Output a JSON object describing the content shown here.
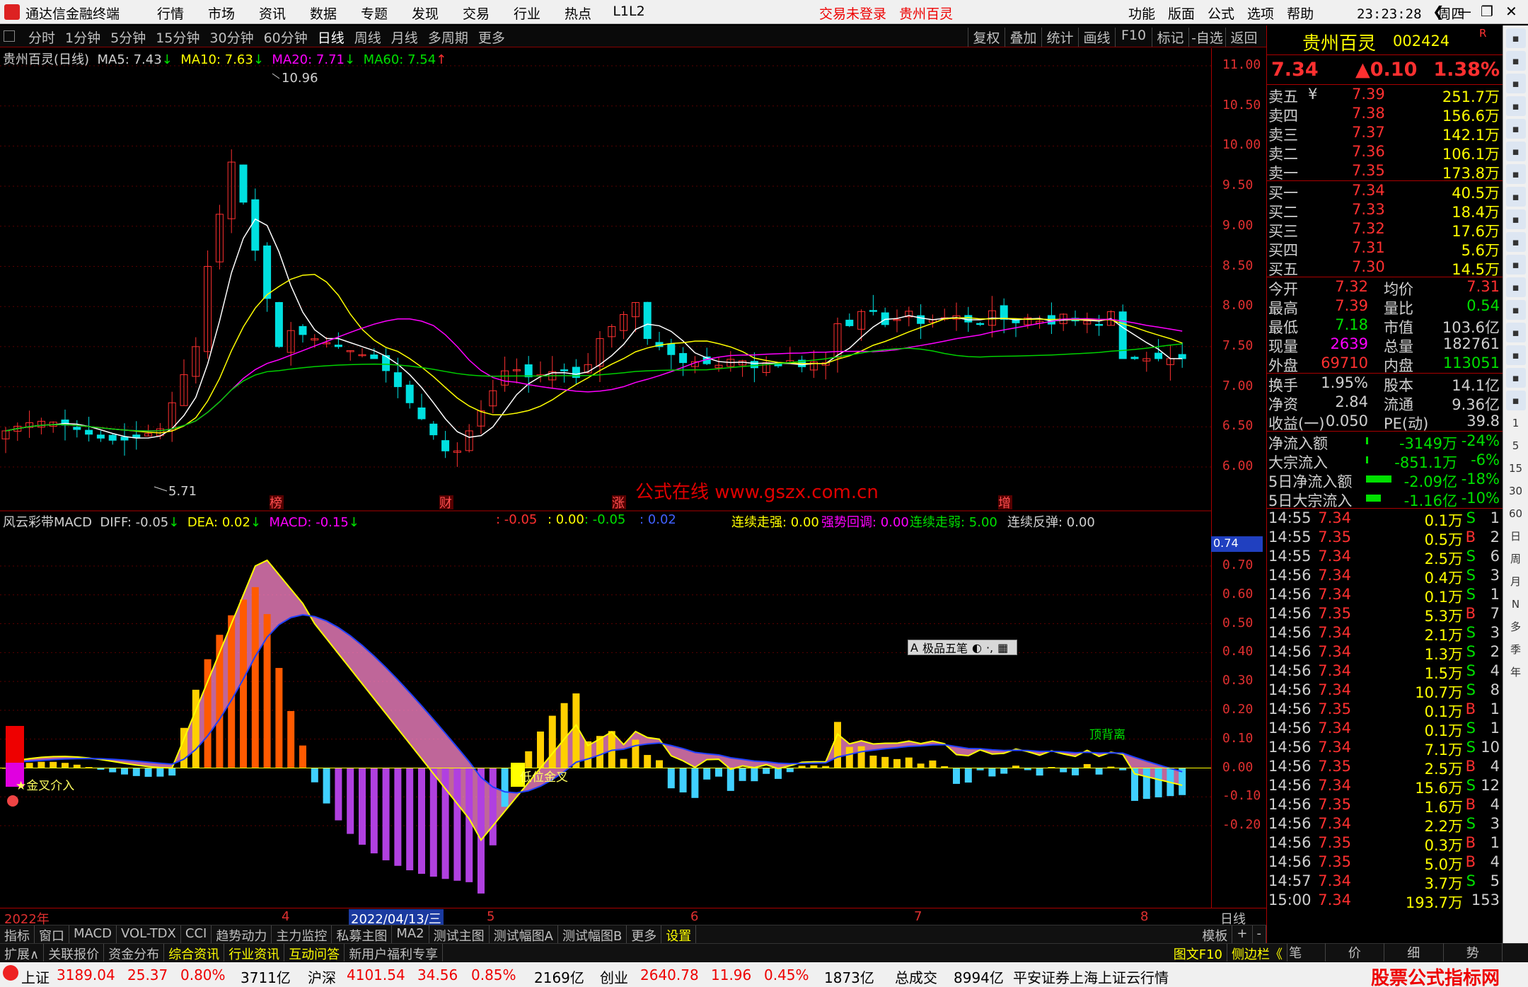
{
  "titlebar": {
    "app_title": "通达信金融终端",
    "menu": [
      "行情",
      "市场",
      "资讯",
      "数据",
      "专题",
      "发现",
      "交易",
      "行业",
      "热点",
      "L1L2"
    ],
    "trade_status": "交易未登录",
    "stock_name": "贵州百灵",
    "right_menu": [
      "功能",
      "版面",
      "公式",
      "选项",
      "帮助"
    ],
    "time": "23:23:28",
    "weekday": "周四"
  },
  "toolbar": {
    "periods": [
      "分时",
      "1分钟",
      "5分钟",
      "15分钟",
      "30分钟",
      "60分钟",
      "日线",
      "周线",
      "月线",
      "多周期",
      "更多"
    ],
    "selected": "日线",
    "tools": [
      "复权",
      "叠加",
      "统计",
      "画线",
      "F10",
      "标记",
      "-自选",
      "返回"
    ]
  },
  "main_chart": {
    "title": "贵州百灵(日线)",
    "ma5": "MA5: 7.43",
    "ma10": "MA10: 7.63",
    "ma20": "MA20: 7.71",
    "ma60": "MA60: 7.54",
    "high_label": "10.96",
    "low_label": "5.71",
    "yticks": [
      "11.00",
      "10.50",
      "10.00",
      "9.50",
      "9.00",
      "8.50",
      "8.00",
      "7.50",
      "7.00",
      "6.50",
      "6.00"
    ],
    "markers": [
      "榜",
      "财",
      "涨",
      "增"
    ],
    "watermark": "公式在线 www.gszx.com.cn"
  },
  "macd_chart": {
    "title": "风云彩带MACD",
    "diff": "DIFF: -0.05",
    "dea": "DEA: 0.02",
    "macd": "MACD: -0.15",
    "extra1": ": -0.05",
    "extra2": ": 0.00",
    "extra3": ": -0.05",
    "extra4": ": 0.02",
    "lianxu_qiang": "连续走强: 0.00",
    "qiangshi": "强势回调: 0.00",
    "lianxu_ruo": "连续走弱: 5.00",
    "fantan": "连续反弹: 0.00",
    "axis_value": "0.74",
    "yticks": [
      "0.70",
      "0.60",
      "0.50",
      "0.40",
      "0.30",
      "0.20",
      "0.10",
      "0.00",
      "-0.10",
      "-0.20"
    ],
    "label_jincha": "★金叉介入",
    "label_diwei": "低位金叉",
    "label_beichi": "顶背离",
    "popup": [
      "A",
      "极品五笔",
      "◐",
      "·,",
      "▦"
    ]
  },
  "date_axis": [
    "2022年",
    "4",
    "2022/04/13/三",
    "5",
    "6",
    "7",
    "8"
  ],
  "date_axis_right": "日线",
  "indicator_tabs": [
    "指标",
    "窗口",
    "MACD",
    "VOL-TDX",
    "CCI",
    "趋势动力",
    "主力监控",
    "私募主图",
    "MA2",
    "测试主图",
    "测试幅图A",
    "测试幅图B",
    "更多",
    "设置"
  ],
  "indicator_right": [
    "模板",
    "+",
    "-"
  ],
  "bottom_tabs": [
    "扩展∧",
    "关联报价",
    "资金分布",
    "综合资讯",
    "行业资讯",
    "互动问答",
    "新用户福利专享"
  ],
  "bottom_right": [
    "图文F10",
    "侧边栏《"
  ],
  "right_panel": {
    "name": "贵州百灵",
    "code": "002424",
    "r": "R",
    "price": "7.34",
    "change": "▲0.10",
    "pct": "1.38%",
    "asks": [
      {
        "label": "卖五",
        "price": "7.39",
        "vol": "251.7万"
      },
      {
        "label": "卖四",
        "price": "7.38",
        "vol": "156.6万"
      },
      {
        "label": "卖三",
        "price": "7.37",
        "vol": "142.1万"
      },
      {
        "label": "卖二",
        "price": "7.36",
        "vol": "106.1万"
      },
      {
        "label": "卖一",
        "price": "7.35",
        "vol": "173.8万"
      }
    ],
    "ask_yen": "¥",
    "bids": [
      {
        "label": "买一",
        "price": "7.34",
        "vol": "40.5万"
      },
      {
        "label": "买二",
        "price": "7.33",
        "vol": "18.4万"
      },
      {
        "label": "买三",
        "price": "7.32",
        "vol": "17.6万"
      },
      {
        "label": "买四",
        "price": "7.31",
        "vol": "5.6万"
      },
      {
        "label": "买五",
        "price": "7.30",
        "vol": "14.5万"
      }
    ],
    "stats1": [
      {
        "l1": "今开",
        "v1": "7.32",
        "l2": "均价",
        "v2": "7.31"
      },
      {
        "l1": "最高",
        "v1": "7.39",
        "l2": "量比",
        "v2": "0.54"
      },
      {
        "l1": "最低",
        "v1": "7.18",
        "l2": "市值",
        "v2": "103.6亿"
      },
      {
        "l1": "现量",
        "v1": "2639",
        "l2": "总量",
        "v2": "182761"
      },
      {
        "l1": "外盘",
        "v1": "69710",
        "l2": "内盘",
        "v2": "113051"
      }
    ],
    "stats2": [
      {
        "l1": "换手",
        "v1": "1.95%",
        "l2": "股本",
        "v2": "14.1亿"
      },
      {
        "l1": "净资",
        "v1": "2.84",
        "l2": "流通",
        "v2": "9.36亿"
      },
      {
        "l1": "收益(一)",
        "v1": "0.050",
        "l2": "PE(动)",
        "v2": "39.8"
      }
    ],
    "flows": [
      {
        "label": "净流入额",
        "value": "-3149万",
        "pct": "-24%",
        "bar": 0.02
      },
      {
        "label": "大宗流入",
        "value": "-851.1万",
        "pct": "-6%",
        "bar": 0.01
      },
      {
        "label": "5日净流入额",
        "value": "-2.09亿",
        "pct": "-18%",
        "bar": 0.6
      },
      {
        "label": "5日大宗流入",
        "value": "-1.16亿",
        "pct": "-10%",
        "bar": 0.35
      }
    ],
    "ticks": [
      {
        "t": "14:55",
        "p": "7.34",
        "v": "0.1万",
        "d": "S",
        "n": "1"
      },
      {
        "t": "14:55",
        "p": "7.35",
        "v": "0.5万",
        "d": "B",
        "n": "2"
      },
      {
        "t": "14:55",
        "p": "7.34",
        "v": "2.5万",
        "d": "S",
        "n": "6"
      },
      {
        "t": "14:56",
        "p": "7.34",
        "v": "0.4万",
        "d": "S",
        "n": "3"
      },
      {
        "t": "14:56",
        "p": "7.34",
        "v": "0.1万",
        "d": "S",
        "n": "1"
      },
      {
        "t": "14:56",
        "p": "7.35",
        "v": "5.3万",
        "d": "B",
        "n": "7"
      },
      {
        "t": "14:56",
        "p": "7.34",
        "v": "2.1万",
        "d": "S",
        "n": "3"
      },
      {
        "t": "14:56",
        "p": "7.34",
        "v": "1.3万",
        "d": "S",
        "n": "2"
      },
      {
        "t": "14:56",
        "p": "7.34",
        "v": "1.5万",
        "d": "S",
        "n": "4"
      },
      {
        "t": "14:56",
        "p": "7.34",
        "v": "10.7万",
        "d": "S",
        "n": "8"
      },
      {
        "t": "14:56",
        "p": "7.35",
        "v": "0.1万",
        "d": "B",
        "n": "1"
      },
      {
        "t": "14:56",
        "p": "7.34",
        "v": "0.1万",
        "d": "S",
        "n": "1"
      },
      {
        "t": "14:56",
        "p": "7.34",
        "v": "7.1万",
        "d": "S",
        "n": "10"
      },
      {
        "t": "14:56",
        "p": "7.35",
        "v": "2.5万",
        "d": "B",
        "n": "4"
      },
      {
        "t": "14:56",
        "p": "7.34",
        "v": "15.6万",
        "d": "S",
        "n": "12"
      },
      {
        "t": "14:56",
        "p": "7.35",
        "v": "1.6万",
        "d": "B",
        "n": "4"
      },
      {
        "t": "14:56",
        "p": "7.34",
        "v": "2.2万",
        "d": "S",
        "n": "3"
      },
      {
        "t": "14:56",
        "p": "7.35",
        "v": "0.3万",
        "d": "B",
        "n": "1"
      },
      {
        "t": "14:56",
        "p": "7.35",
        "v": "5.0万",
        "d": "B",
        "n": "4"
      },
      {
        "t": "14:57",
        "p": "7.34",
        "v": "3.7万",
        "d": "S",
        "n": "5"
      },
      {
        "t": "15:00",
        "p": "7.34",
        "v": "193.7万",
        "d": "",
        "n": "153"
      }
    ],
    "tabs": [
      "笔",
      "价",
      "细",
      "势"
    ]
  },
  "sidebar_labels": [
    "1",
    "5",
    "15",
    "30",
    "60",
    "日",
    "周",
    "月",
    "N",
    "多",
    "季",
    "年"
  ],
  "statusbar": {
    "sh_label": "上证",
    "sh_val": "3189.04",
    "sh_chg": "25.37",
    "sh_pct": "0.80%",
    "sh_amt": "3711亿",
    "sz_label": "沪深",
    "sz_val": "4101.54",
    "sz_chg": "34.56",
    "sz_pct": "0.85%",
    "sz_amt": "2169亿",
    "cy_label": "创业",
    "cy_val": "2640.78",
    "cy_chg": "11.96",
    "cy_pct": "0.45%",
    "cy_amt": "1873亿",
    "total_label": "总成交",
    "total": "8994亿",
    "broker": "平安证券上海上证云行情",
    "brand": "股票公式指标网",
    "brand_url": "www.gszx.com"
  },
  "colors": {
    "up": "#ff3030",
    "down": "#00e0e0",
    "ma5": "#ffffff",
    "ma10": "#ffff00",
    "ma20": "#ff00ff",
    "ma60": "#00d000"
  }
}
